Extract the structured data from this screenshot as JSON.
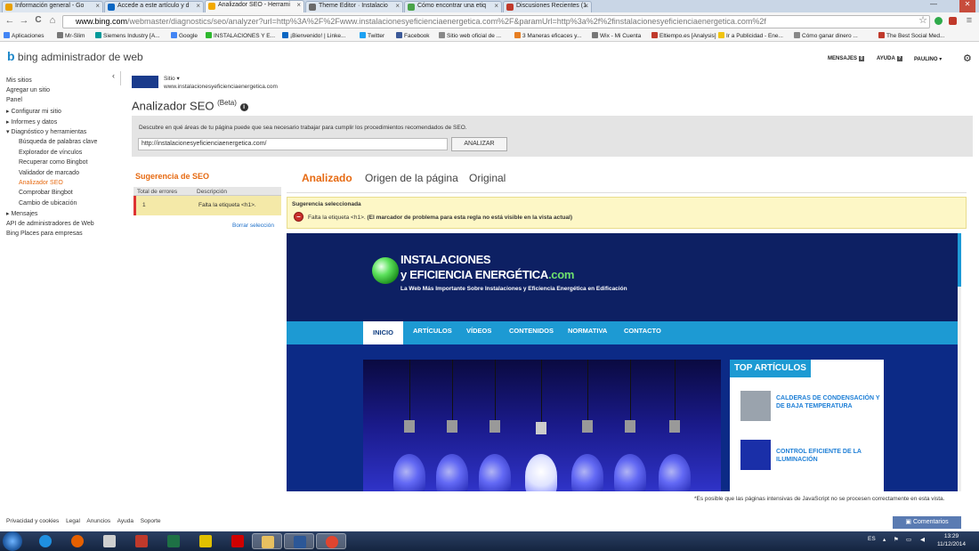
{
  "browser": {
    "tabs": [
      {
        "title": "Información general - Go",
        "color": "#e8a000"
      },
      {
        "title": "Accede a este artículo y d",
        "color": "#0a66c2"
      },
      {
        "title": "Analizador SEO - Herrami",
        "color": "#f2a900"
      },
      {
        "title": "Theme Editor · Instalacio",
        "color": "#6a6a6a"
      },
      {
        "title": "Cómo encontrar una etiq",
        "color": "#4aa34a"
      },
      {
        "title": "Discusiones Recientes (1.",
        "color": "#c0392b"
      }
    ],
    "win_minimize": "—",
    "win_close": "✕",
    "url_host": "www.bing.com",
    "url_path": "/webmaster/diagnostics/seo/analyzer?url=http%3A%2F%2Fwww.instalacionesyeficienciaenergetica.com%2F&paramUrl=http%3a%2f%2finstalacionesyeficienciaenergetica.com%2f",
    "back_icon": "←",
    "forward_icon": "→",
    "reload_icon": "C",
    "home_icon": "⌂",
    "star_icon": "☆",
    "menu_icon": "≡",
    "bookmarks": [
      {
        "label": "Aplicaciones",
        "color": "#4285f4"
      },
      {
        "label": "Mr-Slim",
        "color": "#777"
      },
      {
        "label": "Siemens Industry [A...",
        "color": "#009999"
      },
      {
        "label": "Google",
        "color": "#4285f4"
      },
      {
        "label": "INSTALACIONES Y E...",
        "color": "#2eb82e"
      },
      {
        "label": "¡Bienvenido! | Linke...",
        "color": "#0a66c2"
      },
      {
        "label": "Twitter",
        "color": "#1da1f2"
      },
      {
        "label": "Facebook",
        "color": "#3b5998"
      },
      {
        "label": "Sitio web oficial de ...",
        "color": "#888"
      },
      {
        "label": "3 Maneras eficaces y...",
        "color": "#e67e22"
      },
      {
        "label": "Wix - Mi Cuenta",
        "color": "#777"
      },
      {
        "label": "Eltiempo.es [Analysis]",
        "color": "#c0392b"
      },
      {
        "label": "Ir a Publicidad - Ene...",
        "color": "#f1c40f"
      },
      {
        "label": "Cómo ganar dinero ...",
        "color": "#888"
      },
      {
        "label": "The Best Social Med...",
        "color": "#c0392b"
      }
    ]
  },
  "bing": {
    "logo_b": "b",
    "logo_text": "bing",
    "product": "administrador de web",
    "mensajes": "MENSAJES",
    "mensajes_count": "0",
    "ayuda": "AYUDA",
    "ayuda_icon": "?",
    "user": "PAULINO",
    "gear_icon": "⚙"
  },
  "sidebar": {
    "collapse_icon": "‹",
    "items": [
      {
        "label": "Mis sitios"
      },
      {
        "label": "Agregar un sitio"
      },
      {
        "label": "Panel"
      },
      {
        "label": "▸  Configurar mi sitio"
      },
      {
        "label": "▸  Informes y datos"
      },
      {
        "label": "▾  Diagnóstico y herramientas"
      },
      {
        "label": "Búsqueda de palabras clave"
      },
      {
        "label": "Explorador de vínculos"
      },
      {
        "label": "Recuperar como Bingbot"
      },
      {
        "label": "Validador de marcado"
      },
      {
        "label": "Analizador SEO"
      },
      {
        "label": "Comprobar Bingbot"
      },
      {
        "label": "Cambio de ubicación"
      },
      {
        "label": "▸  Mensajes"
      },
      {
        "label": "API de administradores de Web"
      },
      {
        "label": "Bing Places para empresas"
      }
    ]
  },
  "site": {
    "label": "Sitio ▾",
    "url": "www.instalacionesyeficienciaenergetica.com"
  },
  "page": {
    "title": "Analizador SEO",
    "title_sup": "(Beta)",
    "info_icon": "i",
    "description": "Descubre en qué áreas de tu página puede que sea necesario trabajar para cumplir los procedimientos recomendados de SEO.",
    "input_value": "http://instalacionesyeficienciaenergetica.com/",
    "analyze_button": "ANALIZAR"
  },
  "suggestions": {
    "title": "Sugerencia de SEO",
    "col_errors": "Total de errores",
    "col_desc": "Descripción",
    "rows": [
      {
        "count": "1",
        "desc": "Falta la etiqueta <h1>."
      }
    ],
    "clear_link": "Borrar selección"
  },
  "preview_tabs": {
    "analyzed": "Analizado",
    "source": "Origen de la página",
    "original": "Original"
  },
  "selected": {
    "title": "Sugerencia seleccionada",
    "message": "Falta la etiqueta <h1>.",
    "message_bold": "(El marcador de problema para esta regla no está visible en la vista actual)"
  },
  "preview": {
    "logo_line1": "INSTALACIONES",
    "logo_line2": "y EFICIENCIA ENERGÉTICA",
    "logo_tld": ".com",
    "tagline": "La Web Más Importante Sobre Instalaciones y Eficiencia Energética en Edificación",
    "nav": [
      "INICIO",
      "ARTÍCULOS",
      "VÍDEOS",
      "CONTENIDOS",
      "NORMATIVA",
      "CONTACTO"
    ],
    "top_title": "TOP ARTÍCULOS",
    "articles": [
      {
        "title": "CALDERAS DE CONDENSACIÓN Y DE BAJA TEMPERATURA",
        "color": "#9aa3ad"
      },
      {
        "title": "CONTROL EFICIENTE DE LA ILUMINACIÓN",
        "color": "#1a2fa8"
      }
    ]
  },
  "note": "*Es posible que las páginas intensivas de JavaScript no se procesen correctamente en esta vista.",
  "footer": {
    "links": [
      "Privacidad y cookies",
      "Legal",
      "Anuncios",
      "Ayuda",
      "Soporte"
    ],
    "comments": "Comentarios"
  },
  "taskbar": {
    "apps": [
      {
        "name": "ie",
        "color": "#1f8fe0"
      },
      {
        "name": "firefox",
        "color": "#e66000"
      },
      {
        "name": "notepad",
        "color": "#cfcfcf"
      },
      {
        "name": "powerpoint",
        "color": "#c0392b"
      },
      {
        "name": "excel",
        "color": "#1e7145"
      },
      {
        "name": "app",
        "color": "#e0c000"
      },
      {
        "name": "acrobat",
        "color": "#d00000"
      },
      {
        "name": "explorer",
        "color": "#e8c060"
      },
      {
        "name": "word",
        "color": "#2b5797"
      },
      {
        "name": "chrome",
        "color": "#e0452f"
      }
    ],
    "lang": "ES",
    "time": "13:29",
    "date": "11/12/2014"
  }
}
